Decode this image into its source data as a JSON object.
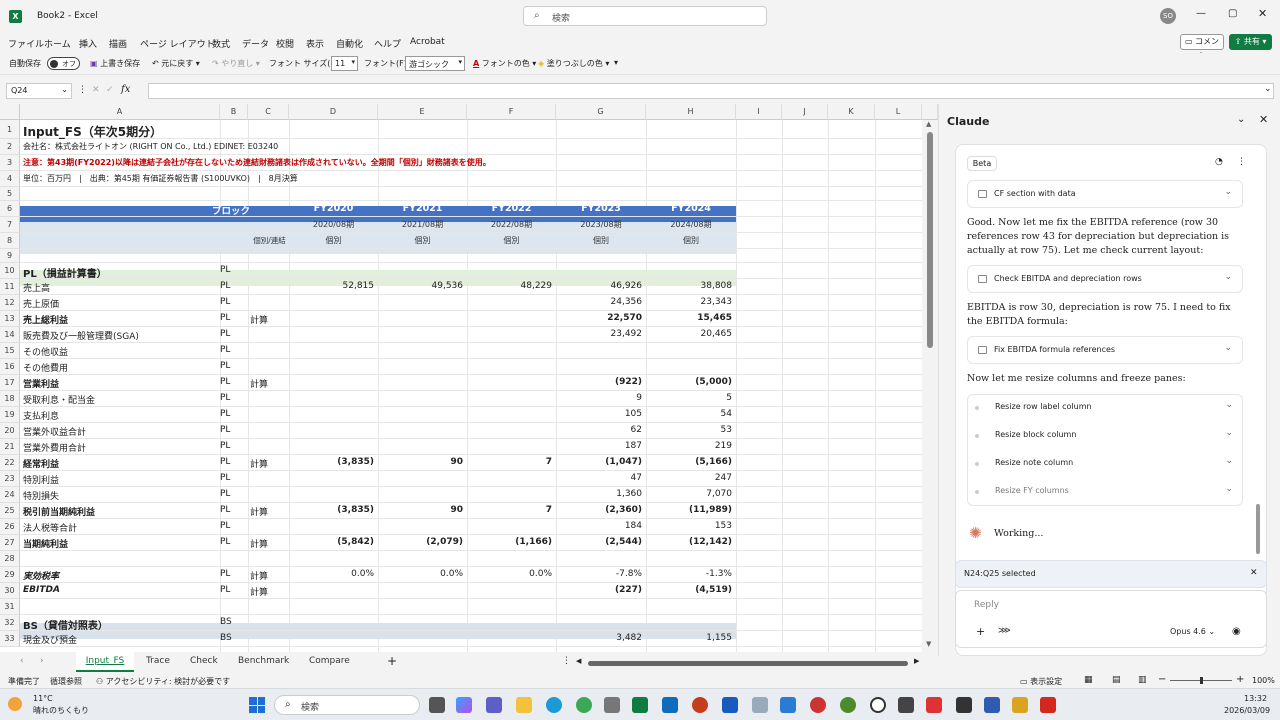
{
  "window": {
    "title": "Book2 - Excel",
    "search_placeholder": "検索",
    "user_initials": "SO",
    "comment_label": "コメント",
    "share_label": "共有"
  },
  "menu": [
    "ファイル",
    "ホーム",
    "挿入",
    "描画",
    "ページ レイアウト",
    "数式",
    "データ",
    "校閲",
    "表示",
    "自動化",
    "ヘルプ",
    "Acrobat"
  ],
  "toolbar": {
    "autosave": "自動保存",
    "autosave_state": "オフ",
    "save": "上書き保存",
    "undo": "元に戻す",
    "redo": "やり直し",
    "font_size_label": "フォント サイズ(F):",
    "font_size": "11",
    "font_label": "フォント(F):",
    "font_name": "游ゴシック",
    "font_color": "フォントの色",
    "fill_color": "塗りつぶしの色"
  },
  "formula": {
    "namebox": "Q24",
    "fx": "fx",
    "value": ""
  },
  "columns": [
    "A",
    "B",
    "C",
    "D",
    "E",
    "F",
    "G",
    "H",
    "I",
    "J",
    "K",
    "L"
  ],
  "rows": {
    "r1": {
      "a": "Input_FS（年次5期分）"
    },
    "r2": {
      "a": "会社名：株式会社ライトオン (RIGHT ON Co., Ltd.)  EDINET: E03240"
    },
    "r3": {
      "a": "注意：第43期(FY2022)以降は連結子会社が存在しないため連結財務諸表は作成されていない。全期間「個別」財務諸表を使用。"
    },
    "r4": {
      "a": "単位：百万円　|　出典：第45期 有価証券報告書 (S100UVKO)　|　8月決算"
    },
    "r6": {
      "b": "ブロック",
      "d": "FY2020",
      "e": "FY2021",
      "f": "FY2022",
      "g": "FY2023",
      "h": "FY2024"
    },
    "r7": {
      "d": "2020/08期",
      "e": "2021/08期",
      "f": "2022/08期",
      "g": "2023/08期",
      "h": "2024/08期"
    },
    "r8": {
      "c": "個別/連結",
      "d": "個別",
      "e": "個別",
      "f": "個別",
      "g": "個別",
      "h": "個別"
    },
    "r10": {
      "a": "PL（損益計算書）",
      "b": "PL"
    },
    "r11": {
      "a": "売上高",
      "b": "PL",
      "d": "52,815",
      "e": "49,536",
      "f": "48,229",
      "g": "46,926",
      "h": "38,808"
    },
    "r12": {
      "a": "売上原価",
      "b": "PL",
      "g": "24,356",
      "h": "23,343"
    },
    "r13": {
      "a": "売上総利益",
      "b": "PL",
      "c": "計算",
      "g": "22,570",
      "h": "15,465"
    },
    "r14": {
      "a": "販売費及び一般管理費(SGA)",
      "b": "PL",
      "g": "23,492",
      "h": "20,465"
    },
    "r15": {
      "a": "その他収益",
      "b": "PL"
    },
    "r16": {
      "a": "その他費用",
      "b": "PL"
    },
    "r17": {
      "a": "営業利益",
      "b": "PL",
      "c": "計算",
      "g": "(922)",
      "h": "(5,000)"
    },
    "r18": {
      "a": "受取利息・配当金",
      "b": "PL",
      "g": "9",
      "h": "5"
    },
    "r19": {
      "a": "支払利息",
      "b": "PL",
      "g": "105",
      "h": "54"
    },
    "r20": {
      "a": "営業外収益合計",
      "b": "PL",
      "g": "62",
      "h": "53"
    },
    "r21": {
      "a": "営業外費用合計",
      "b": "PL",
      "g": "187",
      "h": "219"
    },
    "r22": {
      "a": "経常利益",
      "b": "PL",
      "c": "計算",
      "d": "(3,835)",
      "e": "90",
      "f": "7",
      "g": "(1,047)",
      "h": "(5,166)"
    },
    "r23": {
      "a": "特別利益",
      "b": "PL",
      "g": "47",
      "h": "247"
    },
    "r24": {
      "a": "特別損失",
      "b": "PL",
      "g": "1,360",
      "h": "7,070"
    },
    "r25": {
      "a": "税引前当期純利益",
      "b": "PL",
      "c": "計算",
      "d": "(3,835)",
      "e": "90",
      "f": "7",
      "g": "(2,360)",
      "h": "(11,989)"
    },
    "r26": {
      "a": "法人税等合計",
      "b": "PL",
      "g": "184",
      "h": "153"
    },
    "r27": {
      "a": "当期純利益",
      "b": "PL",
      "c": "計算",
      "d": "(5,842)",
      "e": "(2,079)",
      "f": "(1,166)",
      "g": "(2,544)",
      "h": "(12,142)"
    },
    "r29": {
      "a": "実効税率",
      "b": "PL",
      "c": "計算",
      "d": "0.0%",
      "e": "0.0%",
      "f": "0.0%",
      "g": "-7.8%",
      "h": "-1.3%"
    },
    "r30": {
      "a": "EBITDA",
      "b": "PL",
      "c": "計算",
      "g": "(227)",
      "h": "(4,519)"
    },
    "r32": {
      "a": "BS（貸借対照表）",
      "b": "BS"
    },
    "r33": {
      "a": "現金及び預金",
      "b": "BS",
      "g": "3,482",
      "h": "1,155"
    }
  },
  "sheet_tabs": [
    "Input_FS",
    "Trace",
    "Check",
    "Benchmark",
    "Compare"
  ],
  "status": {
    "ready": "準備完了",
    "circular": "循環参照",
    "accessibility": "アクセシビリティ: 検討が必要です",
    "display_settings": "表示設定",
    "zoom": "100%"
  },
  "claude": {
    "title": "Claude",
    "badge": "Beta",
    "card1": "CF section with data",
    "text1": "Good. Now let me fix the EBITDA reference (row 30 references row 43 for depreciation but depreciation is actually at row 75). Let me check current layout:",
    "card2": "Check EBITDA and depreciation rows",
    "text2": "EBITDA is row 30, depreciation is row 75. I need to fix the EBITDA formula:",
    "card3": "Fix EBITDA formula references",
    "text3": "Now let me resize columns and freeze panes:",
    "steps": [
      "Resize row label column",
      "Resize block column",
      "Resize note column",
      "Resize FY columns"
    ],
    "working": "Working...",
    "selection": "N24:Q25 selected",
    "reply_placeholder": "Reply",
    "model": "Opus 4.6"
  },
  "taskbar": {
    "weather_temp": "11°C",
    "weather_desc": "晴れのちくもり",
    "search": "検索",
    "time": "13:32",
    "date": "2026/03/09"
  },
  "colors": {
    "header_blue": "#4472c4",
    "sub_blue": "#dce6f1",
    "pl_green": "#e2efda",
    "bs_gray": "#d9e1ea",
    "excel_green": "#107c41"
  }
}
